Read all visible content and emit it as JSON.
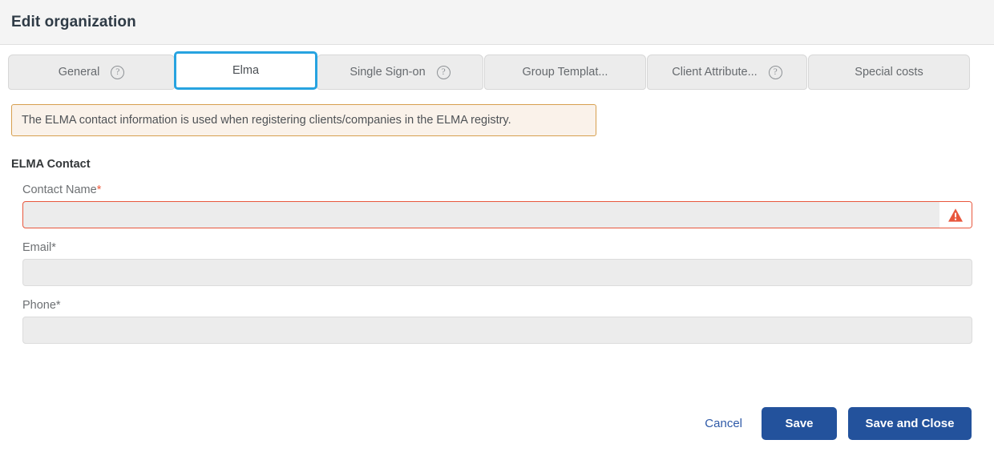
{
  "header": {
    "title": "Edit organization"
  },
  "tabs": [
    {
      "label": "General",
      "help": true,
      "active": false,
      "help_glyph": "?"
    },
    {
      "label": "Elma",
      "help": false,
      "active": true,
      "help_glyph": "?"
    },
    {
      "label": "Single Sign-on",
      "help": true,
      "active": false,
      "help_glyph": "?"
    },
    {
      "label": "Group Templat...",
      "help": false,
      "active": false,
      "help_glyph": "?"
    },
    {
      "label": "Client Attribute...",
      "help": true,
      "active": false,
      "help_glyph": "?"
    },
    {
      "label": "Special costs",
      "help": false,
      "active": false,
      "help_glyph": "?"
    }
  ],
  "banner": {
    "text": "The ELMA contact information is used when registering clients/companies in the ELMA registry.",
    "border_color": "#d79f4e",
    "background_color": "#faf2ea"
  },
  "section": {
    "title": "ELMA Contact"
  },
  "fields": [
    {
      "label": "Contact Name",
      "required_marker": "*",
      "marker_is_red": true,
      "value": "",
      "placeholder": "",
      "has_error": true,
      "error_icon": "warning-triangle-icon"
    },
    {
      "label": "Email*",
      "required_marker": "",
      "marker_is_red": false,
      "value": "",
      "placeholder": "",
      "has_error": false,
      "error_icon": ""
    },
    {
      "label": "Phone*",
      "required_marker": "",
      "marker_is_red": false,
      "value": "",
      "placeholder": "",
      "has_error": false,
      "error_icon": ""
    }
  ],
  "footer": {
    "cancel_label": "Cancel",
    "save_label": "Save",
    "save_close_label": "Save and Close"
  },
  "colors": {
    "active_tab_border": "#27a3e0",
    "primary_button": "#23529c",
    "link": "#2f5aa8",
    "error": "#e8573d",
    "tab_background": "#ececec",
    "header_background": "#f4f4f4"
  }
}
